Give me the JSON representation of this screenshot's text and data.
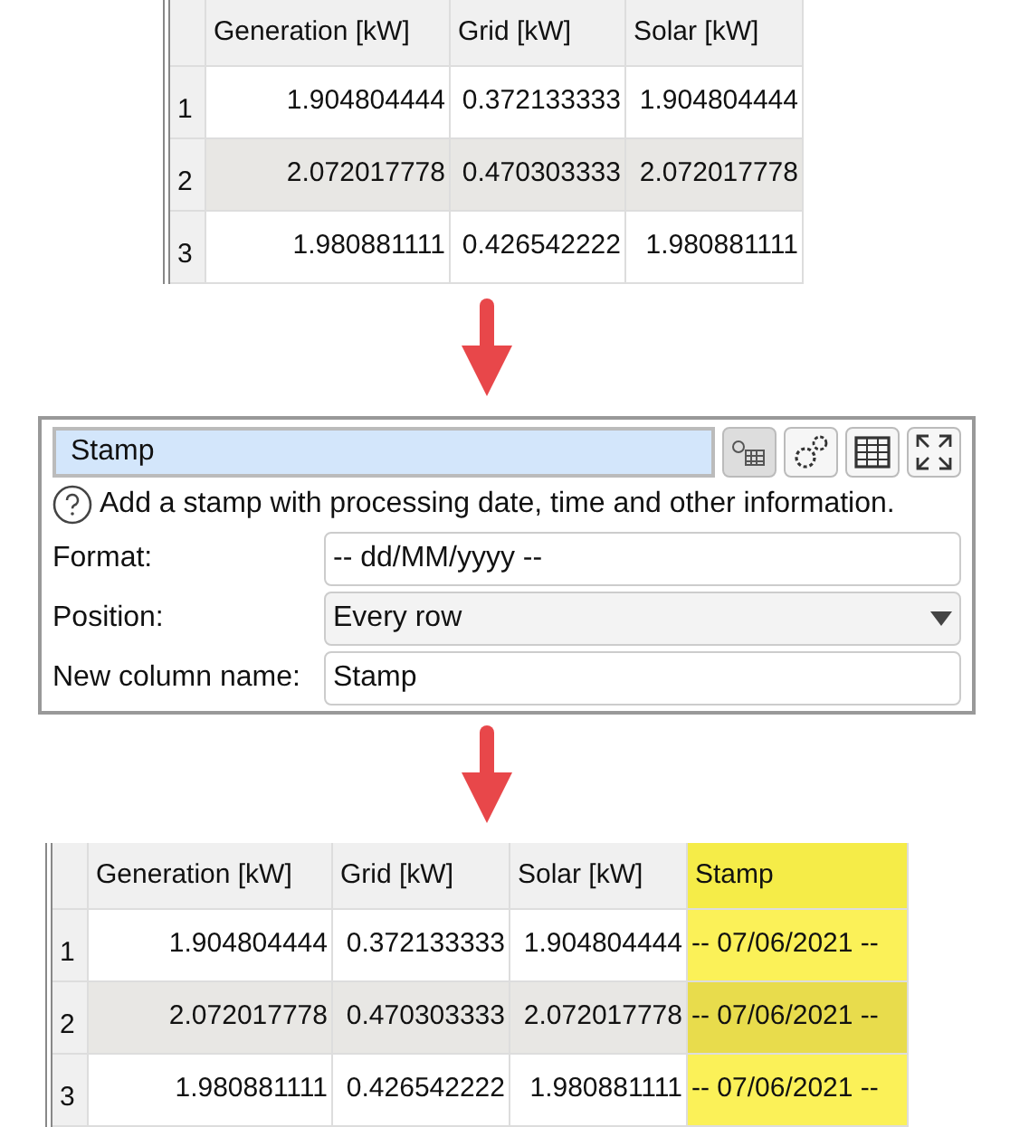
{
  "input_table": {
    "columns": [
      {
        "label": "Generation [kW]",
        "highlighted": false
      },
      {
        "label": "Grid [kW]",
        "highlighted": false
      },
      {
        "label": "Solar [kW]",
        "highlighted": false
      }
    ],
    "rows": [
      {
        "number": "1",
        "cells": [
          "1.904804444",
          "0.372133333",
          "1.904804444"
        ]
      },
      {
        "number": "2",
        "cells": [
          "2.072017778",
          "0.470303333",
          "2.072017778"
        ]
      },
      {
        "number": "3",
        "cells": [
          "1.980881111",
          "0.426542222",
          "1.980881111"
        ]
      }
    ]
  },
  "panel": {
    "title": "Stamp",
    "help": "Add a stamp with processing date, time and other information.",
    "fields": [
      {
        "kind": "text",
        "label": "Format:",
        "value": "-- dd/MM/yyyy --"
      },
      {
        "kind": "select",
        "label": "Position:",
        "value": "Every row"
      },
      {
        "kind": "text",
        "label": "New column name:",
        "value": "Stamp"
      }
    ]
  },
  "output_table": {
    "columns": [
      {
        "label": "Generation [kW]",
        "highlighted": false
      },
      {
        "label": "Grid [kW]",
        "highlighted": false
      },
      {
        "label": "Solar [kW]",
        "highlighted": false
      },
      {
        "label": "Stamp",
        "highlighted": true
      }
    ],
    "rows": [
      {
        "number": "1",
        "cells": [
          "1.904804444",
          "0.372133333",
          "1.904804444",
          "-- 07/06/2021 --"
        ]
      },
      {
        "number": "2",
        "cells": [
          "2.072017778",
          "0.470303333",
          "2.072017778",
          "-- 07/06/2021 --"
        ]
      },
      {
        "number": "3",
        "cells": [
          "1.980881111",
          "0.426542222",
          "1.980881111",
          "-- 07/06/2021 --"
        ]
      }
    ]
  }
}
